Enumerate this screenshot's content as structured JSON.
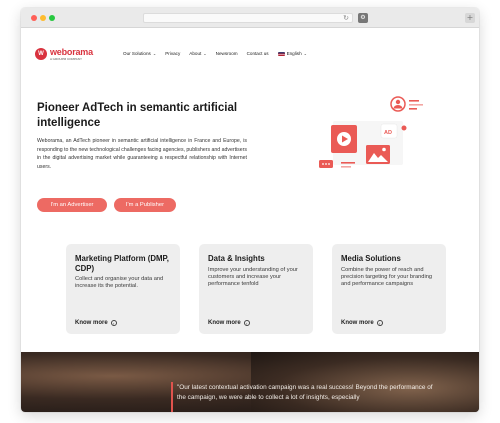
{
  "browser": {
    "reload_glyph": "↻",
    "extension_glyph": "⚙",
    "newtab_glyph": "+"
  },
  "brand": {
    "name": "weborama",
    "tagline": "A GROUPM COMPANY",
    "mark": "W",
    "color": "#d9333f"
  },
  "nav": {
    "items": [
      {
        "label": "Our Solutions",
        "has_dropdown": true
      },
      {
        "label": "Privacy",
        "has_dropdown": false
      },
      {
        "label": "About",
        "has_dropdown": true
      },
      {
        "label": "Newsroom",
        "has_dropdown": false
      },
      {
        "label": "Contact us",
        "has_dropdown": false
      },
      {
        "label": "English",
        "has_dropdown": true,
        "icon": "us-flag-icon"
      }
    ]
  },
  "hero": {
    "title": "Pioneer AdTech in semantic artificial intelligence",
    "description": "Weborama, an AdTech pioneer in semantic artificial intelligence in France and Europe, is responding to the new technological challenges facing agencies, publishers and advertisers in the digital advertising market while guaranteeing a respectful relationship with Internet users.",
    "buttons": {
      "advertiser": "I'm an Advertiser",
      "publisher": "I'm a Publisher"
    },
    "accent_color": "#ed6a63",
    "illustration_badge": "AD"
  },
  "cards": [
    {
      "title": "Marketing Platform (DMP, CDP)",
      "text": "Collect and organise your data and increase its the potential.",
      "link": "Know more"
    },
    {
      "title": "Data & Insights",
      "text": "Improve your understanding of your customers and increase your performance tenfold",
      "link": "Know more"
    },
    {
      "title": "Media Solutions",
      "text": "Combine the power of reach and precision targeting for your branding and performance campaigns",
      "link": "Know more"
    }
  ],
  "testimonial": {
    "text": "\"Our latest contextual activation campaign was a real success! Beyond the performance of the campaign, we were able to collect a lot of insights, especially"
  }
}
